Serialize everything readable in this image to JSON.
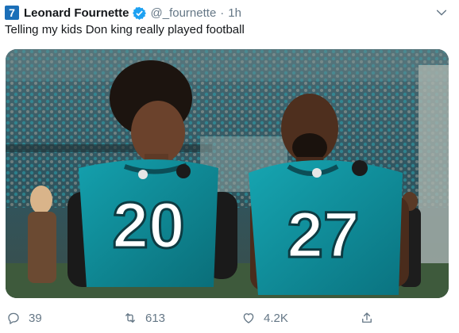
{
  "tweet": {
    "avatar_text": "7",
    "author_name": "Leonard Fournette",
    "handle": "@_fournette",
    "separator": "·",
    "time": "1h",
    "text": "Telling my kids Don king really played football"
  },
  "jersey": {
    "left_number": "20",
    "right_number": "27"
  },
  "actions": {
    "reply_count": "39",
    "retweet_count": "613",
    "like_count": "4.2K"
  },
  "colors": {
    "brand_blue": "#1da1f2",
    "muted": "#657786",
    "teal_jersey": "#0f8a96"
  }
}
